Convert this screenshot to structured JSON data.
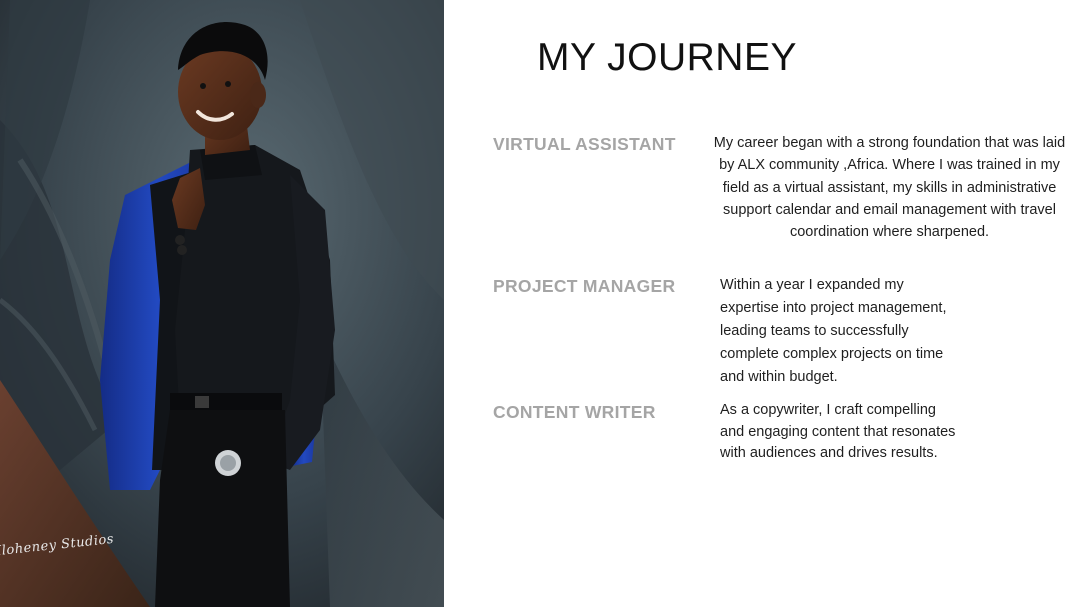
{
  "photo": {
    "description_icon": "portrait-photo",
    "signature_text": "Iloheney Studios"
  },
  "title": "MY JOURNEY",
  "roles": [
    {
      "title": "VIRTUAL ASSISTANT",
      "description": "My career began with a strong foundation that was laid\nby  ALX community ,Africa. Where I was trained in  my\nfield as a virtual assistant,  my skills in administrative\nsupport calendar and email management with travel\ncoordination where sharpened."
    },
    {
      "title": "PROJECT MANAGER",
      "description": "Within a year I expanded my\nexpertise into project management,\nleading teams to successfully\ncomplete complex projects on time\nand within budget."
    },
    {
      "title": "CONTENT WRITER",
      "description": " As a copywriter, I craft compelling\nand engaging content that resonates\nwith audiences and drives results."
    }
  ],
  "colors": {
    "role_title": "#a5a5a5",
    "body_text": "#1f1f1f",
    "heading": "#111111",
    "jacket": "#1e3fa8"
  }
}
